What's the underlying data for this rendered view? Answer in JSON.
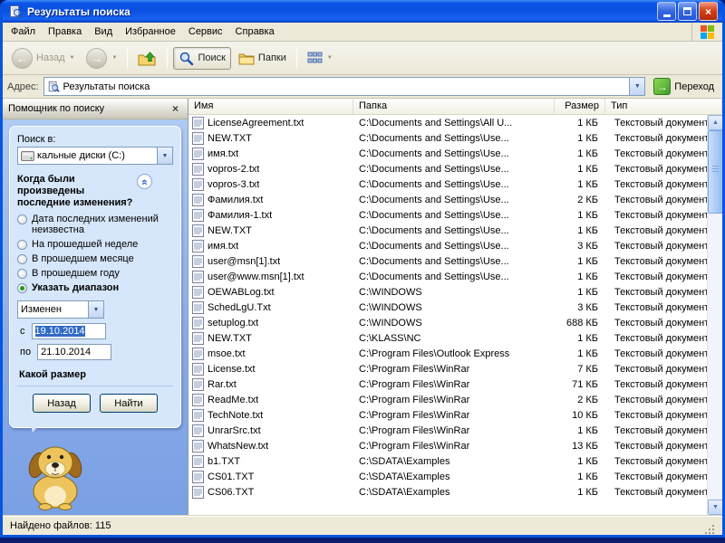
{
  "window": {
    "title": "Результаты поиска",
    "status_text": "Найдено файлов: 115"
  },
  "menu": {
    "items": [
      "Файл",
      "Правка",
      "Вид",
      "Избранное",
      "Сервис",
      "Справка"
    ]
  },
  "toolbar": {
    "back_label": "Назад",
    "search_label": "Поиск",
    "folders_label": "Папки"
  },
  "address": {
    "label": "Адрес:",
    "value": "Результаты поиска",
    "go_label": "Переход"
  },
  "search_panel": {
    "title": "Помощник по поиску",
    "search_in_label": "Поиск в:",
    "search_in_value": "кальные диски (C:)",
    "date_question": "Когда были произведены последние изменения?",
    "options": [
      {
        "label": "Дата последних изменений неизвестна",
        "selected": false
      },
      {
        "label": "На прошедшей неделе",
        "selected": false
      },
      {
        "label": "В прошедшем месяце",
        "selected": false
      },
      {
        "label": "В прошедшем году",
        "selected": false
      },
      {
        "label": "Указать диапазон",
        "selected": true
      }
    ],
    "modified_value": "Изменен",
    "from_label": "с",
    "from_value": "19.10.2014",
    "to_label": "по",
    "to_value": "21.10.2014",
    "size_question": "Какой размер",
    "back_button": "Назад",
    "find_button": "Найти"
  },
  "file_list": {
    "columns": [
      "Имя",
      "Папка",
      "Размер",
      "Тип"
    ],
    "rows": [
      {
        "name": "LicenseAgreement.txt",
        "folder": "C:\\Documents and Settings\\All U...",
        "size": "1 КБ",
        "type": "Текстовый документ"
      },
      {
        "name": "NEW.TXT",
        "folder": "C:\\Documents and Settings\\Use...",
        "size": "1 КБ",
        "type": "Текстовый документ"
      },
      {
        "name": "имя.txt",
        "folder": "C:\\Documents and Settings\\Use...",
        "size": "1 КБ",
        "type": "Текстовый документ"
      },
      {
        "name": "vopros-2.txt",
        "folder": "C:\\Documents and Settings\\Use...",
        "size": "1 КБ",
        "type": "Текстовый документ"
      },
      {
        "name": "vopros-3.txt",
        "folder": "C:\\Documents and Settings\\Use...",
        "size": "1 КБ",
        "type": "Текстовый документ"
      },
      {
        "name": "Фамилия.txt",
        "folder": "C:\\Documents and Settings\\Use...",
        "size": "2 КБ",
        "type": "Текстовый документ"
      },
      {
        "name": "Фамилия-1.txt",
        "folder": "C:\\Documents and Settings\\Use...",
        "size": "1 КБ",
        "type": "Текстовый документ"
      },
      {
        "name": "NEW.TXT",
        "folder": "C:\\Documents and Settings\\Use...",
        "size": "1 КБ",
        "type": "Текстовый документ"
      },
      {
        "name": "имя.txt",
        "folder": "C:\\Documents and Settings\\Use...",
        "size": "3 КБ",
        "type": "Текстовый документ"
      },
      {
        "name": "user@msn[1].txt",
        "folder": "C:\\Documents and Settings\\Use...",
        "size": "1 КБ",
        "type": "Текстовый документ"
      },
      {
        "name": "user@www.msn[1].txt",
        "folder": "C:\\Documents and Settings\\Use...",
        "size": "1 КБ",
        "type": "Текстовый документ"
      },
      {
        "name": "OEWABLog.txt",
        "folder": "C:\\WINDOWS",
        "size": "1 КБ",
        "type": "Текстовый документ"
      },
      {
        "name": "SchedLgU.Txt",
        "folder": "C:\\WINDOWS",
        "size": "3 КБ",
        "type": "Текстовый документ"
      },
      {
        "name": "setuplog.txt",
        "folder": "C:\\WINDOWS",
        "size": "688 КБ",
        "type": "Текстовый документ"
      },
      {
        "name": "NEW.TXT",
        "folder": "C:\\KLASS\\NC",
        "size": "1 КБ",
        "type": "Текстовый документ"
      },
      {
        "name": "msoe.txt",
        "folder": "C:\\Program Files\\Outlook Express",
        "size": "1 КБ",
        "type": "Текстовый документ"
      },
      {
        "name": "License.txt",
        "folder": "C:\\Program Files\\WinRar",
        "size": "7 КБ",
        "type": "Текстовый документ"
      },
      {
        "name": "Rar.txt",
        "folder": "C:\\Program Files\\WinRar",
        "size": "71 КБ",
        "type": "Текстовый документ"
      },
      {
        "name": "ReadMe.txt",
        "folder": "C:\\Program Files\\WinRar",
        "size": "2 КБ",
        "type": "Текстовый документ"
      },
      {
        "name": "TechNote.txt",
        "folder": "C:\\Program Files\\WinRar",
        "size": "10 КБ",
        "type": "Текстовый документ"
      },
      {
        "name": "UnrarSrc.txt",
        "folder": "C:\\Program Files\\WinRar",
        "size": "1 КБ",
        "type": "Текстовый документ"
      },
      {
        "name": "WhatsNew.txt",
        "folder": "C:\\Program Files\\WinRar",
        "size": "13 КБ",
        "type": "Текстовый документ"
      },
      {
        "name": "b1.TXT",
        "folder": "C:\\SDATA\\Examples",
        "size": "1 КБ",
        "type": "Текстовый документ"
      },
      {
        "name": "CS01.TXT",
        "folder": "C:\\SDATA\\Examples",
        "size": "1 КБ",
        "type": "Текстовый документ"
      },
      {
        "name": "CS06.TXT",
        "folder": "C:\\SDATA\\Examples",
        "size": "1 КБ",
        "type": "Текстовый документ"
      }
    ]
  }
}
